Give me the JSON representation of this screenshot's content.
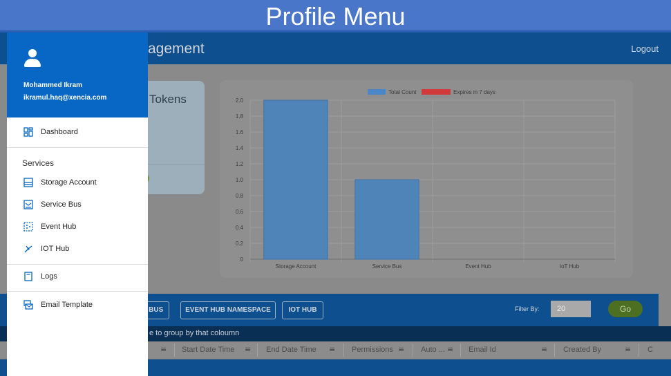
{
  "banner": {
    "title": "Profile Menu"
  },
  "app": {
    "title": "agement",
    "logout_label": "Logout"
  },
  "tokens_card": {
    "title": "Tokens"
  },
  "profile": {
    "name": "Mohammed Ikram",
    "email": "ikramul.haq@xencia.com",
    "avatar_icon": "user-avatar-icon"
  },
  "nav": {
    "dashboard": {
      "label": "Dashboard",
      "icon": "dashboard-icon"
    },
    "services_heading": "Services",
    "storage_account": {
      "label": "Storage Account",
      "icon": "storage-icon"
    },
    "service_bus": {
      "label": "Service Bus",
      "icon": "service-bus-icon"
    },
    "event_hub": {
      "label": "Event Hub",
      "icon": "event-hub-icon"
    },
    "iot_hub": {
      "label": "IOT Hub",
      "icon": "iot-hub-icon"
    },
    "logs": {
      "label": "Logs",
      "icon": "logs-icon"
    },
    "email_template": {
      "label": "Email Template",
      "icon": "email-template-icon"
    }
  },
  "toolbar": {
    "buttons": [
      "E BUS",
      "EVENT HUB NAMESPACE",
      "IOT HUB"
    ],
    "filter_label": "Filter By:",
    "filter_value": "20",
    "go_label": "Go"
  },
  "grid": {
    "group_hint": "e to group by that coloumn",
    "columns": [
      "Start Date Time",
      "End Date Time",
      "Permissions",
      "Auto ...",
      "Email Id",
      "Created By",
      "C"
    ]
  },
  "colors": {
    "accent": "#0867c4",
    "header": "#0e4f8f",
    "bar": "#4e84b8",
    "legend_total": "#4a86c8",
    "legend_expires": "#d03a3a"
  },
  "chart_data": {
    "type": "bar",
    "categories": [
      "Storage Account",
      "Service Bus",
      "Event Hub",
      "IoT Hub"
    ],
    "series": [
      {
        "name": "Total Count",
        "values": [
          2,
          1,
          0,
          0
        ]
      },
      {
        "name": "Expires in 7 days",
        "values": [
          0,
          0,
          0,
          0
        ]
      }
    ],
    "ylim": [
      0,
      2
    ],
    "yticks": [
      "0",
      "0.2",
      "0.4",
      "0.6",
      "0.8",
      "1.0",
      "1.2",
      "1.4",
      "1.6",
      "1.8",
      "2.0"
    ],
    "legend": "top-center",
    "grid": true
  }
}
